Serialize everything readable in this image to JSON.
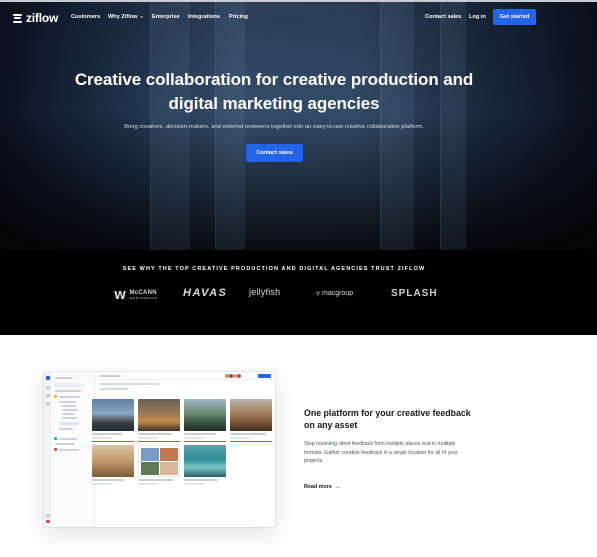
{
  "header": {
    "logo_text": "ziflow",
    "logo_icon": "ziflow-lines-icon",
    "nav": [
      {
        "label": "Customers"
      },
      {
        "label": "Why Ziflow"
      },
      {
        "label": "Enterprise"
      },
      {
        "label": "Integrations"
      },
      {
        "label": "Pricing"
      }
    ],
    "contact_sales": "Contact sales",
    "log_in": "Log in",
    "get_started": "Get started"
  },
  "hero": {
    "title": "Creative collaboration for creative production and digital marketing agencies",
    "subtitle": "Bring creatives, decision-makers, and external reviewers together into an easy-to-use creative collaboration platform.",
    "cta": "Contact sales"
  },
  "trust": {
    "heading": "SEE WHY THE TOP CREATIVE PRODUCTION AND DIGITAL AGENCIES TRUST ZIFLOW",
    "brands": [
      {
        "name": "McCANN",
        "sub": "WORLDGROUP"
      },
      {
        "name": "HAVAS"
      },
      {
        "name": "jellyfish"
      },
      {
        "name": "macgroup"
      },
      {
        "name": "SPLASH"
      }
    ]
  },
  "feature": {
    "title": "One platform for your creative feedback on any asset",
    "body": "Stop receiving client feedback from multiple places and in multiple formats. Gather creative feedback in a single location for all of your projects.",
    "link": "Read more",
    "link_icon": "arrow-right-icon"
  },
  "colors": {
    "accent": "#2364e8",
    "strip_bg": "#000000",
    "hero_overlay": "#0c1220"
  }
}
